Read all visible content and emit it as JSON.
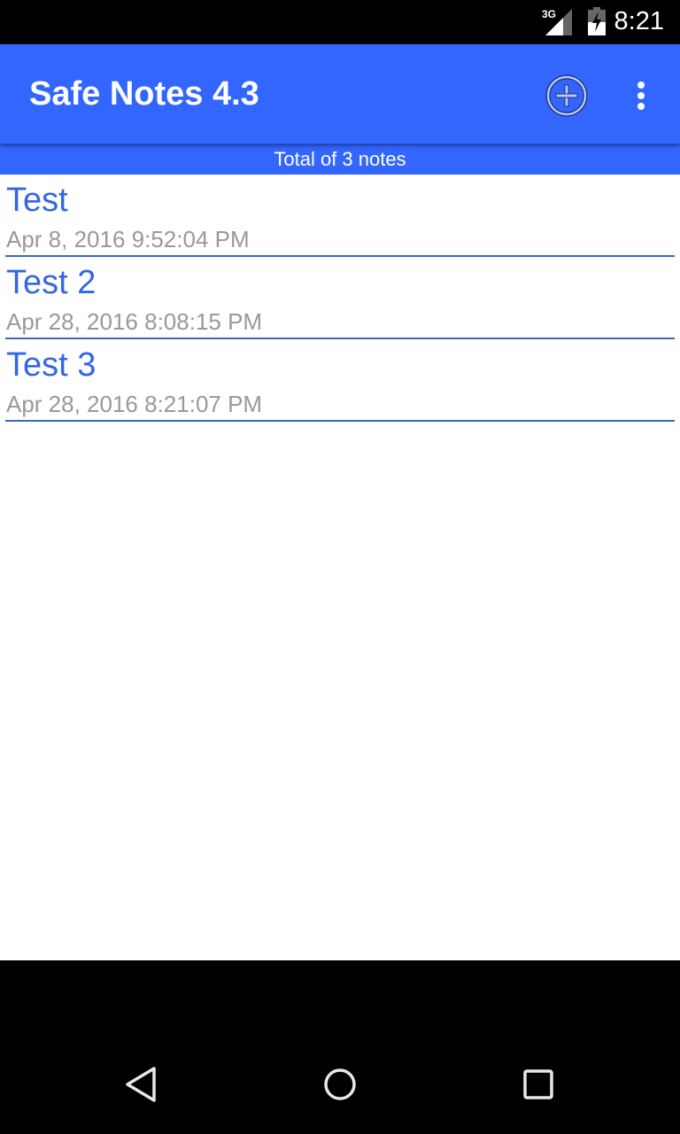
{
  "status_bar": {
    "network": "3G",
    "signal_icon": "signal-icon",
    "battery_icon": "battery-charging-icon",
    "time": "8:21"
  },
  "app_bar": {
    "title": "Safe Notes 4.3",
    "add_icon": "add-circle-icon",
    "more_icon": "more-vert-icon"
  },
  "summary": "Total of 3 notes",
  "notes": [
    {
      "title": "Test",
      "date": "Apr 8, 2016 9:52:04 PM"
    },
    {
      "title": "Test 2",
      "date": "Apr 28, 2016 8:08:15 PM"
    },
    {
      "title": "Test 3",
      "date": "Apr 28, 2016 8:21:07 PM"
    }
  ],
  "nav_bar": {
    "back_icon": "back-icon",
    "home_icon": "home-icon",
    "recents_icon": "recents-icon"
  },
  "colors": {
    "accent": "#3366ff",
    "note_title": "#3366e6",
    "note_date": "#999999",
    "divider": "#3b66c8"
  }
}
